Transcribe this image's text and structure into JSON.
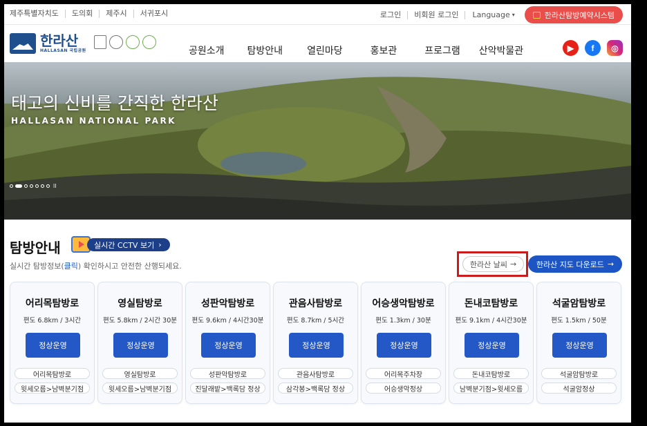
{
  "utility": {
    "left_links": [
      "제주특별자치도",
      "도의회",
      "제주시",
      "서귀포시"
    ],
    "login": "로그인",
    "guest_login": "비회원 로그인",
    "language": "Language",
    "reservation": "한라산탐방예약시스템"
  },
  "logo": {
    "ko": "한라산",
    "en": "HALLASAN 국립공원"
  },
  "nav": [
    "공원소개",
    "탐방안내",
    "열린마당",
    "홍보관",
    "프로그램",
    "산악박물관"
  ],
  "social": {
    "youtube": "▶",
    "facebook": "f",
    "instagram": "◎"
  },
  "hero": {
    "title": "태고의 신비를 간직한 한라산",
    "subtitle": "HALLASAN NATIONAL PARK"
  },
  "section": {
    "title": "탐방안내",
    "cctv": "실시간 CCTV 보기",
    "desc_before": "실시간 탐방정보(",
    "desc_link": "클릭",
    "desc_after": ") 확인하시고 안전한 산행되세요.",
    "weather": "한라산 날씨",
    "map_download": "한라산 지도 다운로드"
  },
  "trails": [
    {
      "name": "어리목탐방로",
      "info": "편도 6.8km / 3시간",
      "status": "정상운영",
      "tag1": "어리목탐방로",
      "tag2": "윗세오름>남벽분기점"
    },
    {
      "name": "영실탐방로",
      "info": "편도 5.8km / 2시간 30분",
      "status": "정상운영",
      "tag1": "영실탐방로",
      "tag2": "윗세오름>남벽분기점"
    },
    {
      "name": "성판악탐방로",
      "info": "편도 9.6km / 4시간30분",
      "status": "정상운영",
      "tag1": "성판악탐방로",
      "tag2": "진달래밭>백록담 정상"
    },
    {
      "name": "관음사탐방로",
      "info": "편도 8.7km / 5시간",
      "status": "정상운영",
      "tag1": "관음사탐방로",
      "tag2": "삼각봉>백록담 정상"
    },
    {
      "name": "어승생악탐방로",
      "info": "편도 1.3km / 30분",
      "status": "정상운영",
      "tag1": "어리목주차장",
      "tag2": "어승생악정상"
    },
    {
      "name": "돈내코탐방로",
      "info": "편도 9.1km / 4시간30분",
      "status": "정상운영",
      "tag1": "돈내코탐방로",
      "tag2": "남벽분기점>윗세오름"
    },
    {
      "name": "석굴암탐방로",
      "info": "편도 1.5km / 50분",
      "status": "정상운영",
      "tag1": "석굴암탐방로",
      "tag2": "석굴암정상"
    }
  ],
  "colors": {
    "reservation": "#e94e4b",
    "primary": "#2458c6",
    "highlight": "#cc1b1b"
  }
}
